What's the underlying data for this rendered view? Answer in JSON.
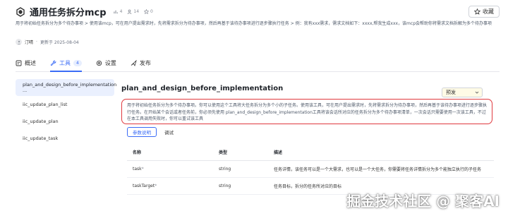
{
  "header": {
    "title": "通用任务拆分mcp",
    "stats": [
      {
        "icon": "chart-icon",
        "value": "4"
      },
      {
        "icon": "users-icon",
        "value": "14"
      },
      {
        "icon": "star-icon",
        "value": "0"
      }
    ],
    "favorite_label": "收藏"
  },
  "description": "用于将初始任务拆分为多个待办事项 > 使用该mcp，可在用户提出需求时，先将需求拆分为待办事项，然后再基于该待办事项进行逐步骤执行任务 > 例：我有xxx需求，需求文档如下：xxxx,帮我生成xxx，该mcp会帮助你将需求文档拆解为多个待办事项",
  "meta": {
    "author": "汀晴",
    "updated": "更新于 2025-08-04"
  },
  "tabs": [
    {
      "label": "概述",
      "icon": "overview-icon"
    },
    {
      "label": "工具",
      "icon": "tool-icon",
      "badge": "4"
    },
    {
      "label": "设置",
      "icon": "settings-icon"
    },
    {
      "label": "发布",
      "icon": "publish-icon"
    }
  ],
  "sidebar": {
    "items": [
      {
        "label": "plan_and_design_before_implementation ..."
      },
      {
        "label": "iic_update_plan_list"
      },
      {
        "label": "iic_update_plan"
      },
      {
        "label": "iic_update_task"
      }
    ]
  },
  "tool": {
    "name": "plan_and_design_before_implementation",
    "version": "预发",
    "description": "用于将初始任务拆分为多个待办事项。你可以使用这个工具将大任务拆分为多个小的子任务。使用该工具，可在用户提出需求时，先将需求拆分为待办事项，然后再基于该待办事项进行逐步骤执行任务。在开始某个会话或者任务前，你必须先使用 plan_and_design_before_implementation工具将该会话所对应的任务拆分为多个待办事项清单，一次会话只需要使用一次该工具，不过在本工具调用失败时，你可以重试该工具",
    "sub_tabs": [
      "参数说明",
      "调试"
    ]
  },
  "params": {
    "headers": [
      "名称",
      "类型",
      "描述"
    ],
    "rows": [
      {
        "name": "task",
        "required": "*",
        "type": "string",
        "desc": "任务详情，该任务可以是一个大需求，也可以是一个大任务，你需要将任务详情拆分为多个能独立执行的子任务"
      },
      {
        "name": "taskTarget",
        "required": "*",
        "type": "string",
        "desc": "任务目标，拆分的任务所对应的目标"
      }
    ]
  },
  "watermark": "掘金技术社区 @ 聚客AI"
}
